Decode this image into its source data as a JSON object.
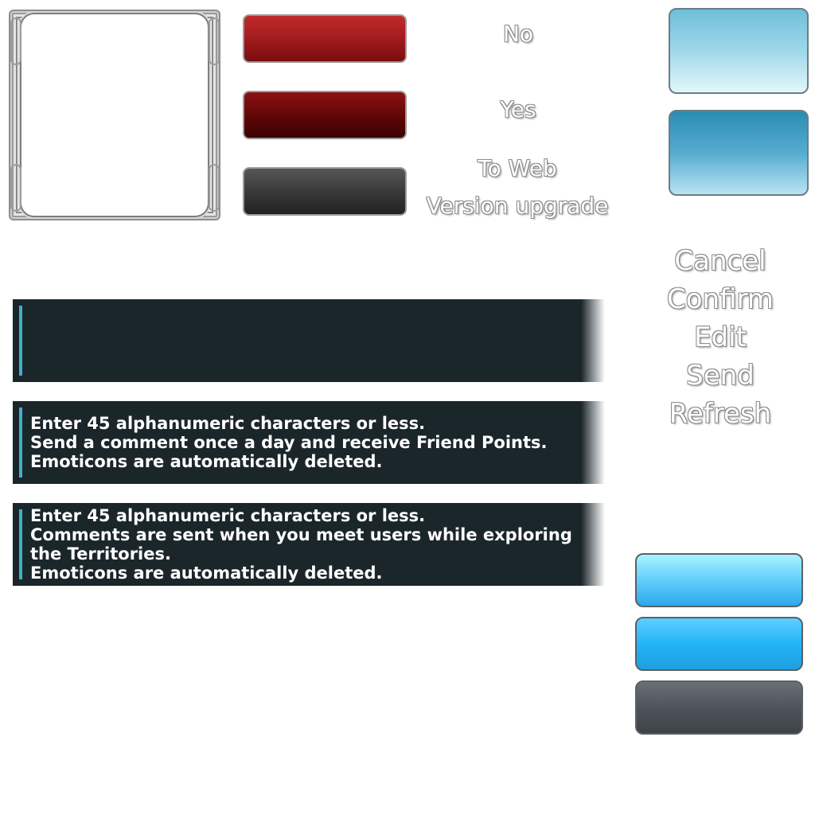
{
  "labels": {
    "no": "No",
    "yes": "Yes",
    "to_web": "To Web",
    "version_upgrade": "Version upgrade"
  },
  "side_labels": {
    "cancel": "Cancel",
    "confirm": "Confirm",
    "edit": "Edit",
    "send": "Send",
    "refresh": "Refresh"
  },
  "text_bars": {
    "bar2": {
      "line1": "Enter 45 alphanumeric characters or less.",
      "line2": "Send a comment once a day and receive Friend Points.",
      "line3": "Emoticons are automatically deleted."
    },
    "bar3": {
      "line1": "Enter 45 alphanumeric characters or less.",
      "line2": "Comments are sent when you meet users while exploring",
      "line3": "the Territories.",
      "line4": "Emoticons are automatically deleted."
    }
  },
  "colors": {
    "accent": "#3fb2c6",
    "dark_bar": "#1b262b",
    "red": "#a61d20",
    "blue": "#23b4f6"
  }
}
